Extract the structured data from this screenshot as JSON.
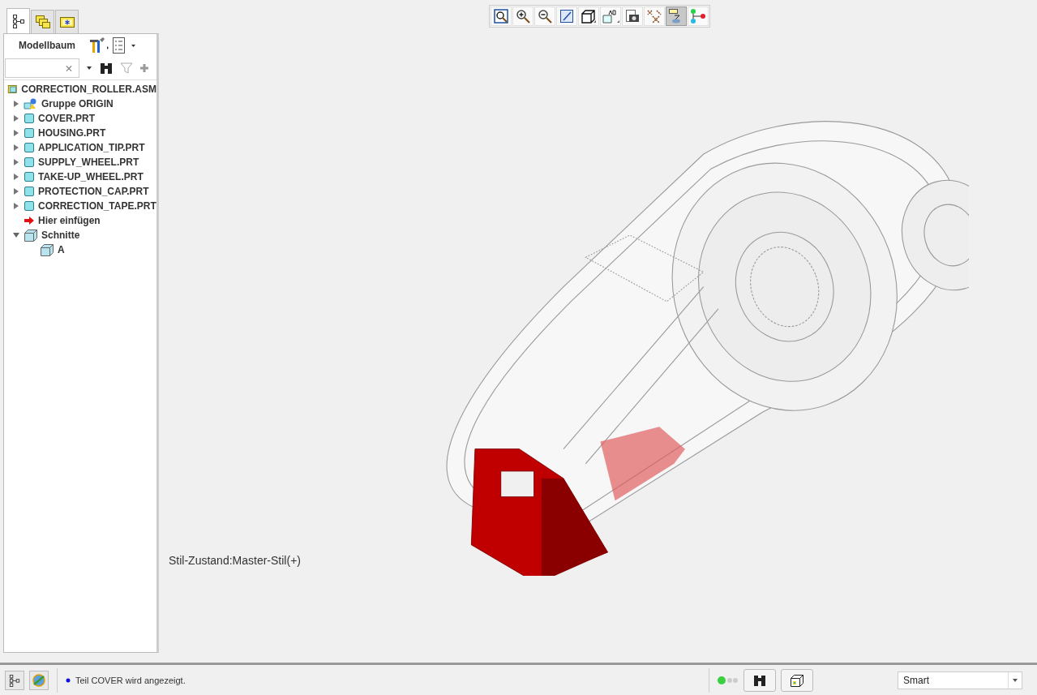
{
  "sidebar": {
    "tabs": [
      {
        "kind": "tree",
        "selected": true
      },
      {
        "kind": "layers",
        "selected": false
      },
      {
        "kind": "favorites",
        "selected": false
      }
    ],
    "title": "Modellbaum",
    "tree": {
      "label": "CORRECTION_ROLLER.ASM",
      "kind": "assembly",
      "children": [
        {
          "label": "Gruppe ORIGIN",
          "kind": "group",
          "expanded": false
        },
        {
          "label": "COVER.PRT",
          "kind": "part",
          "expanded": false
        },
        {
          "label": "HOUSING.PRT",
          "kind": "part",
          "expanded": false
        },
        {
          "label": "APPLICATION_TIP.PRT",
          "kind": "part",
          "expanded": false
        },
        {
          "label": "SUPPLY_WHEEL.PRT",
          "kind": "part",
          "expanded": false
        },
        {
          "label": "TAKE-UP_WHEEL.PRT",
          "kind": "part",
          "expanded": false
        },
        {
          "label": "PROTECTION_CAP.PRT",
          "kind": "part",
          "expanded": false
        },
        {
          "label": "CORRECTION_TAPE.PRT",
          "kind": "part",
          "expanded": false
        },
        {
          "label": "Hier einfügen",
          "kind": "insert"
        },
        {
          "label": "Schnitte",
          "kind": "sections",
          "expanded": true,
          "children": [
            {
              "label": "A",
              "kind": "section"
            }
          ]
        }
      ]
    }
  },
  "toolbar": [
    {
      "kind": "zoom-fit",
      "selected": false
    },
    {
      "kind": "zoom-in",
      "selected": false
    },
    {
      "kind": "zoom-out",
      "selected": false
    },
    {
      "kind": "repaint",
      "selected": false
    },
    {
      "kind": "display-style",
      "selected": false
    },
    {
      "kind": "annotation",
      "selected": false
    },
    {
      "kind": "camera",
      "selected": false
    },
    {
      "kind": "datum",
      "selected": false
    },
    {
      "kind": "spin-center",
      "selected": true
    },
    {
      "kind": "connections",
      "selected": false
    }
  ],
  "viewport": {
    "style_state": "Stil-Zustand:Master-Stil(+)"
  },
  "status_bar": {
    "message": "Teil COVER wird angezeigt.",
    "filter": "Smart"
  }
}
